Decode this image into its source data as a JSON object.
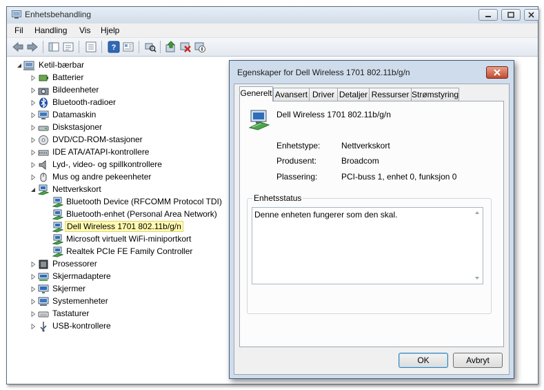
{
  "window": {
    "title": "Enhetsbehandling"
  },
  "menu": [
    "Fil",
    "Handling",
    "Vis",
    "Hjelp"
  ],
  "tree": {
    "root": "Ketil-bærbar",
    "categories": [
      "Batterier",
      "Bildeenheter",
      "Bluetooth-radioer",
      "Datamaskin",
      "Diskstasjoner",
      "DVD/CD-ROM-stasjoner",
      "IDE ATA/ATAPI-kontrollere",
      "Lyd-, video- og spillkontrollere",
      "Mus og andre pekeenheter",
      "Nettverkskort",
      "Prosessorer",
      "Skjermadaptere",
      "Skjermer",
      "Systemenheter",
      "Tastaturer",
      "USB-kontrollere"
    ],
    "network_children": [
      "Bluetooth Device (RFCOMM Protocol TDI)",
      "Bluetooth-enhet (Personal Area Network)",
      "Dell Wireless 1701 802.11b/g/n",
      "Microsoft virtuelt WiFi-miniportkort",
      "Realtek PCIe FE Family Controller"
    ]
  },
  "dialog": {
    "title": "Egenskaper for Dell Wireless 1701 802.11b/g/n",
    "tabs": [
      "Generelt",
      "Avansert",
      "Driver",
      "Detaljer",
      "Ressurser",
      "Strømstyring"
    ],
    "device_name": "Dell Wireless 1701 802.11b/g/n",
    "properties": {
      "type_label": "Enhetstype:",
      "type_value": "Nettverkskort",
      "maker_label": "Produsent:",
      "maker_value": "Broadcom",
      "location_label": "Plassering:",
      "location_value": "PCI-buss 1, enhet 0, funksjon 0"
    },
    "status_group_title": "Enhetsstatus",
    "status_text": "Denne enheten fungerer som den skal.",
    "ok_label": "OK",
    "cancel_label": "Avbryt"
  },
  "colors": {
    "selection_bg": "#fffbb0",
    "dialog_frame": "#cfdceb",
    "close_button": "#c24a2f"
  }
}
